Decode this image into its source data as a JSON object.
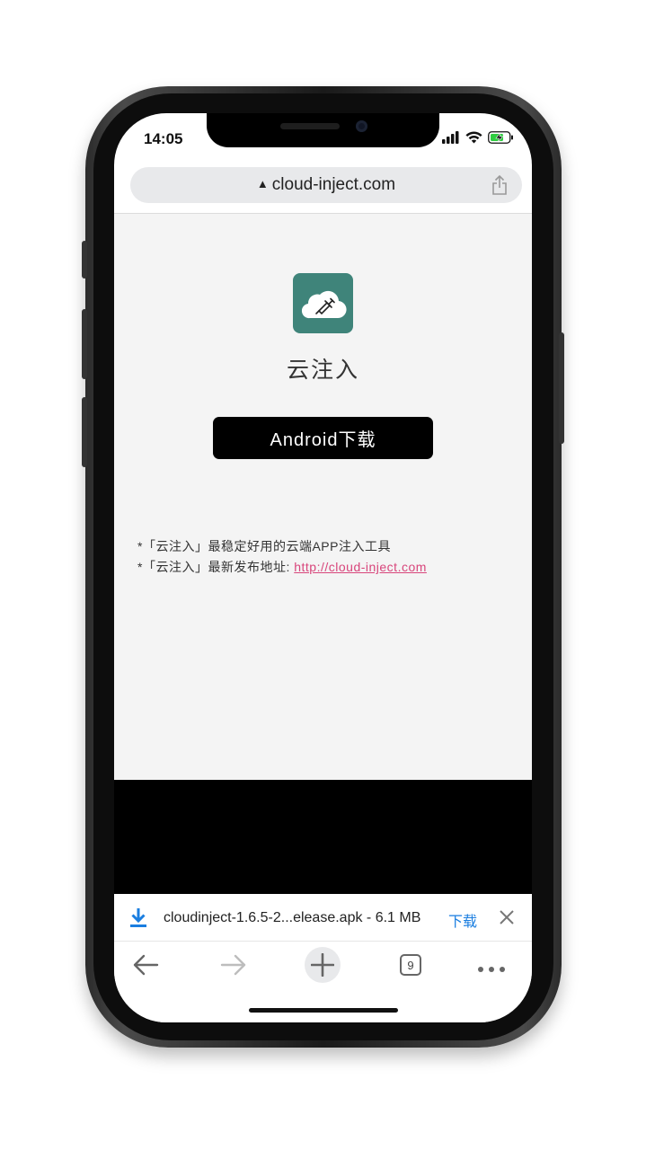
{
  "status_bar": {
    "time": "14:05"
  },
  "browser": {
    "url": "cloud-inject.com",
    "tab_count": "9"
  },
  "app": {
    "name": "云注入",
    "icon": "cloud-syringe-icon",
    "icon_color": "#3f847a"
  },
  "download_button": {
    "label": "Android下载"
  },
  "notes": {
    "line1": "*「云注入」最稳定好用的云端APP注入工具",
    "line2_prefix": "*「云注入」最新发布地址: ",
    "line2_link": "http://cloud-inject.com"
  },
  "download_bar": {
    "filename": "cloudinject-1.6.5-2...elease.apk - 6.1 MB",
    "action_label": "下载",
    "accent": "#1a7ee0"
  },
  "toolbar": {
    "items": [
      "back-icon",
      "forward-icon",
      "new-tab-icon",
      "tabs-icon",
      "more-icon"
    ]
  },
  "colors": {
    "link": "#d8457b",
    "page_bg": "#f4f4f4",
    "button_bg": "#000000"
  }
}
